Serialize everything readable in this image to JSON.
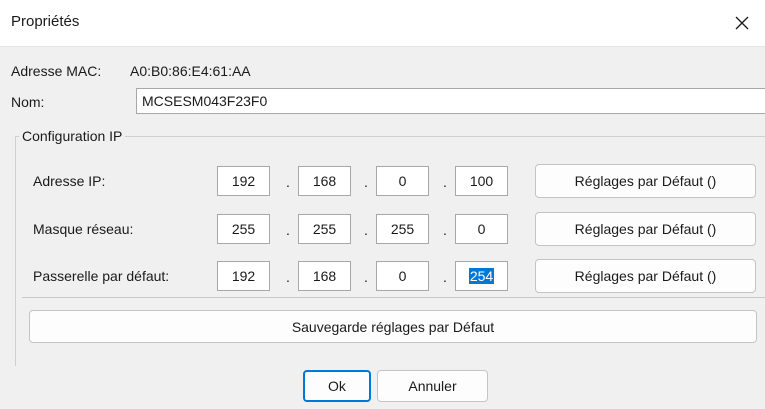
{
  "window": {
    "title": "Propriétés"
  },
  "mac": {
    "label": "Adresse MAC:",
    "value": "A0:B0:86:E4:61:AA"
  },
  "nom": {
    "label": "Nom:",
    "value": "MCSESM043F23F0"
  },
  "ip_config": {
    "group_title": "Configuration IP",
    "rows": [
      {
        "label": "Adresse IP:",
        "octets": [
          "192",
          "168",
          "0",
          "100"
        ],
        "button": "Réglages par Défaut ()"
      },
      {
        "label": "Masque réseau:",
        "octets": [
          "255",
          "255",
          "255",
          "0"
        ],
        "button": "Réglages par Défaut ()"
      },
      {
        "label": "Passerelle par défaut:",
        "octets": [
          "192",
          "168",
          "0",
          "254"
        ],
        "button": "Réglages par Défaut ()"
      }
    ],
    "dot": "."
  },
  "save_defaults_label": "Sauvegarde réglages par Défaut",
  "footer": {
    "ok_label": "Ok",
    "cancel_label": "Annuler"
  }
}
